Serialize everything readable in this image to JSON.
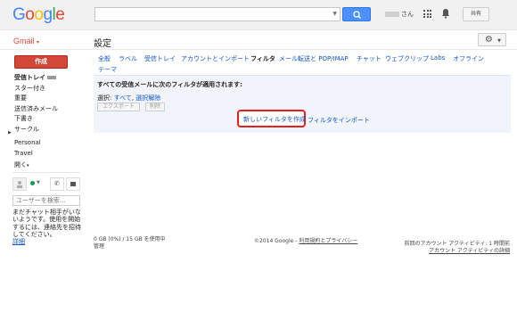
{
  "logo": {
    "letters": [
      "G",
      "o",
      "o",
      "g",
      "l",
      "e"
    ],
    "colors": [
      "#4285f4",
      "#ea4335",
      "#fbbc05",
      "#4285f4",
      "#34a853",
      "#ea4335"
    ]
  },
  "header": {
    "search_value": "",
    "username_suffix": "さん",
    "share_label": "共有"
  },
  "app": {
    "name": "Gmail",
    "caret": "▾",
    "page_title": "設定"
  },
  "compose": {
    "label": "作成"
  },
  "nav": {
    "items": [
      {
        "label": "受信トレイ"
      },
      {
        "label": "スター付き"
      },
      {
        "label": "重要"
      },
      {
        "label": "送信済みメール"
      },
      {
        "label": "下書き"
      },
      {
        "label": "サークル"
      }
    ],
    "labels": [
      "Personal",
      "Travel",
      "開く"
    ],
    "more_caret": "▾"
  },
  "chat": {
    "search_placeholder": "ユーザーを検索...",
    "info": "まだチャット相手がいないようです。使用を開始するには、連絡先を招待してください。",
    "info_link": "詳細"
  },
  "tabs": [
    {
      "label": "全般",
      "active": false
    },
    {
      "label": "ラベル",
      "active": false
    },
    {
      "label": "受信トレイ",
      "active": false
    },
    {
      "label": "アカウントとインポート",
      "active": false
    },
    {
      "label": "フィルタ",
      "active": true
    },
    {
      "label": "メール転送と POP/IMAP",
      "active": false
    },
    {
      "label": "チャット",
      "active": false
    },
    {
      "label": "ウェブクリップ",
      "active": false
    },
    {
      "label": "Labs",
      "active": false
    },
    {
      "label": "オフライン",
      "active": false
    },
    {
      "label": "テーマ",
      "active": false
    }
  ],
  "filters": {
    "heading": "すべての受信メールに次のフィルタが適用されます:",
    "select_prefix": "選択: ",
    "select_all": "すべて",
    "select_none": "選択解除",
    "export_label": "エクスポート",
    "delete_label": "削除",
    "create_label": "新しいフィルタを作成",
    "import_label": "フィルタをインポート"
  },
  "footer": {
    "storage": "0 GB (0%) / 15 GB を使用中",
    "storage_manage": "管理",
    "copyright": "©2014 Google - ",
    "terms_link": "利用規約とプライバシー",
    "activity": "前回のアカウント アクティビティ: 1 時間前",
    "activity_link": "アカウント アクティビティの詳細"
  }
}
